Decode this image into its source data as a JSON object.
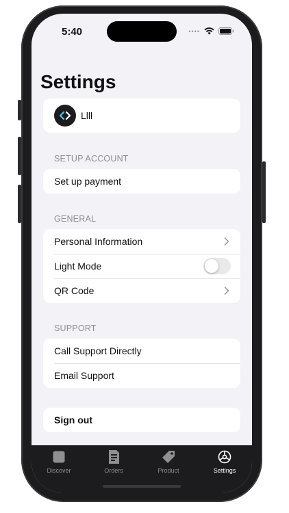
{
  "status_bar": {
    "time": "5:40"
  },
  "page_title": "Settings",
  "profile": {
    "name": "Llll"
  },
  "sections": {
    "setup_account": {
      "label": "SETUP ACCOUNT",
      "items": [
        "Set up payment"
      ]
    },
    "general": {
      "label": "GENERAL",
      "items": [
        "Personal Information",
        "Light Mode",
        "QR Code"
      ],
      "light_mode_on": false
    },
    "support": {
      "label": "SUPPORT",
      "items": [
        "Call Support Directly",
        "Email Support"
      ]
    }
  },
  "sign_out": "Sign out",
  "tabbar": {
    "tabs": [
      {
        "label": "Discover",
        "icon": "square-icon"
      },
      {
        "label": "Orders",
        "icon": "document-icon"
      },
      {
        "label": "Product",
        "icon": "tag-icon"
      },
      {
        "label": "Settings",
        "icon": "gear-icon"
      }
    ],
    "active_index": 3
  },
  "colors": {
    "background": "#f2f2f7",
    "tabbar": "#1c1c1e",
    "secondary_text": "#8e8e93"
  }
}
